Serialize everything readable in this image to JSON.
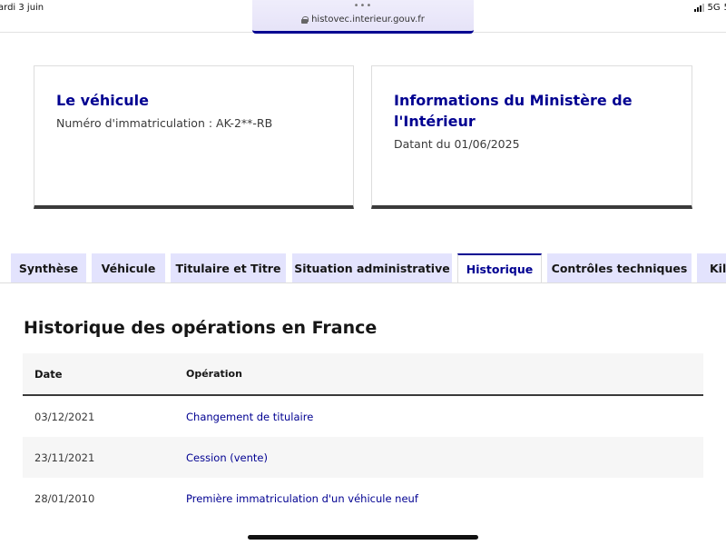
{
  "status_bar": {
    "date": "ardi 3 juin",
    "network": "5G",
    "battery_fragment": "5"
  },
  "browser": {
    "url": "histovec.interieur.gouv.fr",
    "dots": "•••"
  },
  "cards": {
    "vehicule": {
      "title": "Le véhicule",
      "text": "Numéro d'immatriculation : AK-2**-RB"
    },
    "ministere": {
      "title": "Informations du Ministère de l'Intérieur",
      "text": "Datant du 01/06/2025"
    }
  },
  "tabs": [
    {
      "label": "Synthèse",
      "active": false
    },
    {
      "label": "Véhicule",
      "active": false
    },
    {
      "label": "Titulaire et Titre",
      "active": false
    },
    {
      "label": "Situation administrative",
      "active": false
    },
    {
      "label": "Historique",
      "active": true
    },
    {
      "label": "Contrôles techniques",
      "active": false
    },
    {
      "label": "Kilo",
      "active": false
    }
  ],
  "panel": {
    "title": "Historique des opérations en France",
    "table": {
      "headers": [
        "Date",
        "Opération"
      ],
      "rows": [
        {
          "date": "03/12/2021",
          "operation": "Changement de titulaire"
        },
        {
          "date": "23/11/2021",
          "operation": "Cession (vente)"
        },
        {
          "date": "28/01/2010",
          "operation": "Première immatriculation d'un véhicule neuf"
        }
      ]
    }
  },
  "colors": {
    "accent": "#000091",
    "tab_background": "#e3e3fd",
    "row_alt": "#f6f6f6"
  }
}
